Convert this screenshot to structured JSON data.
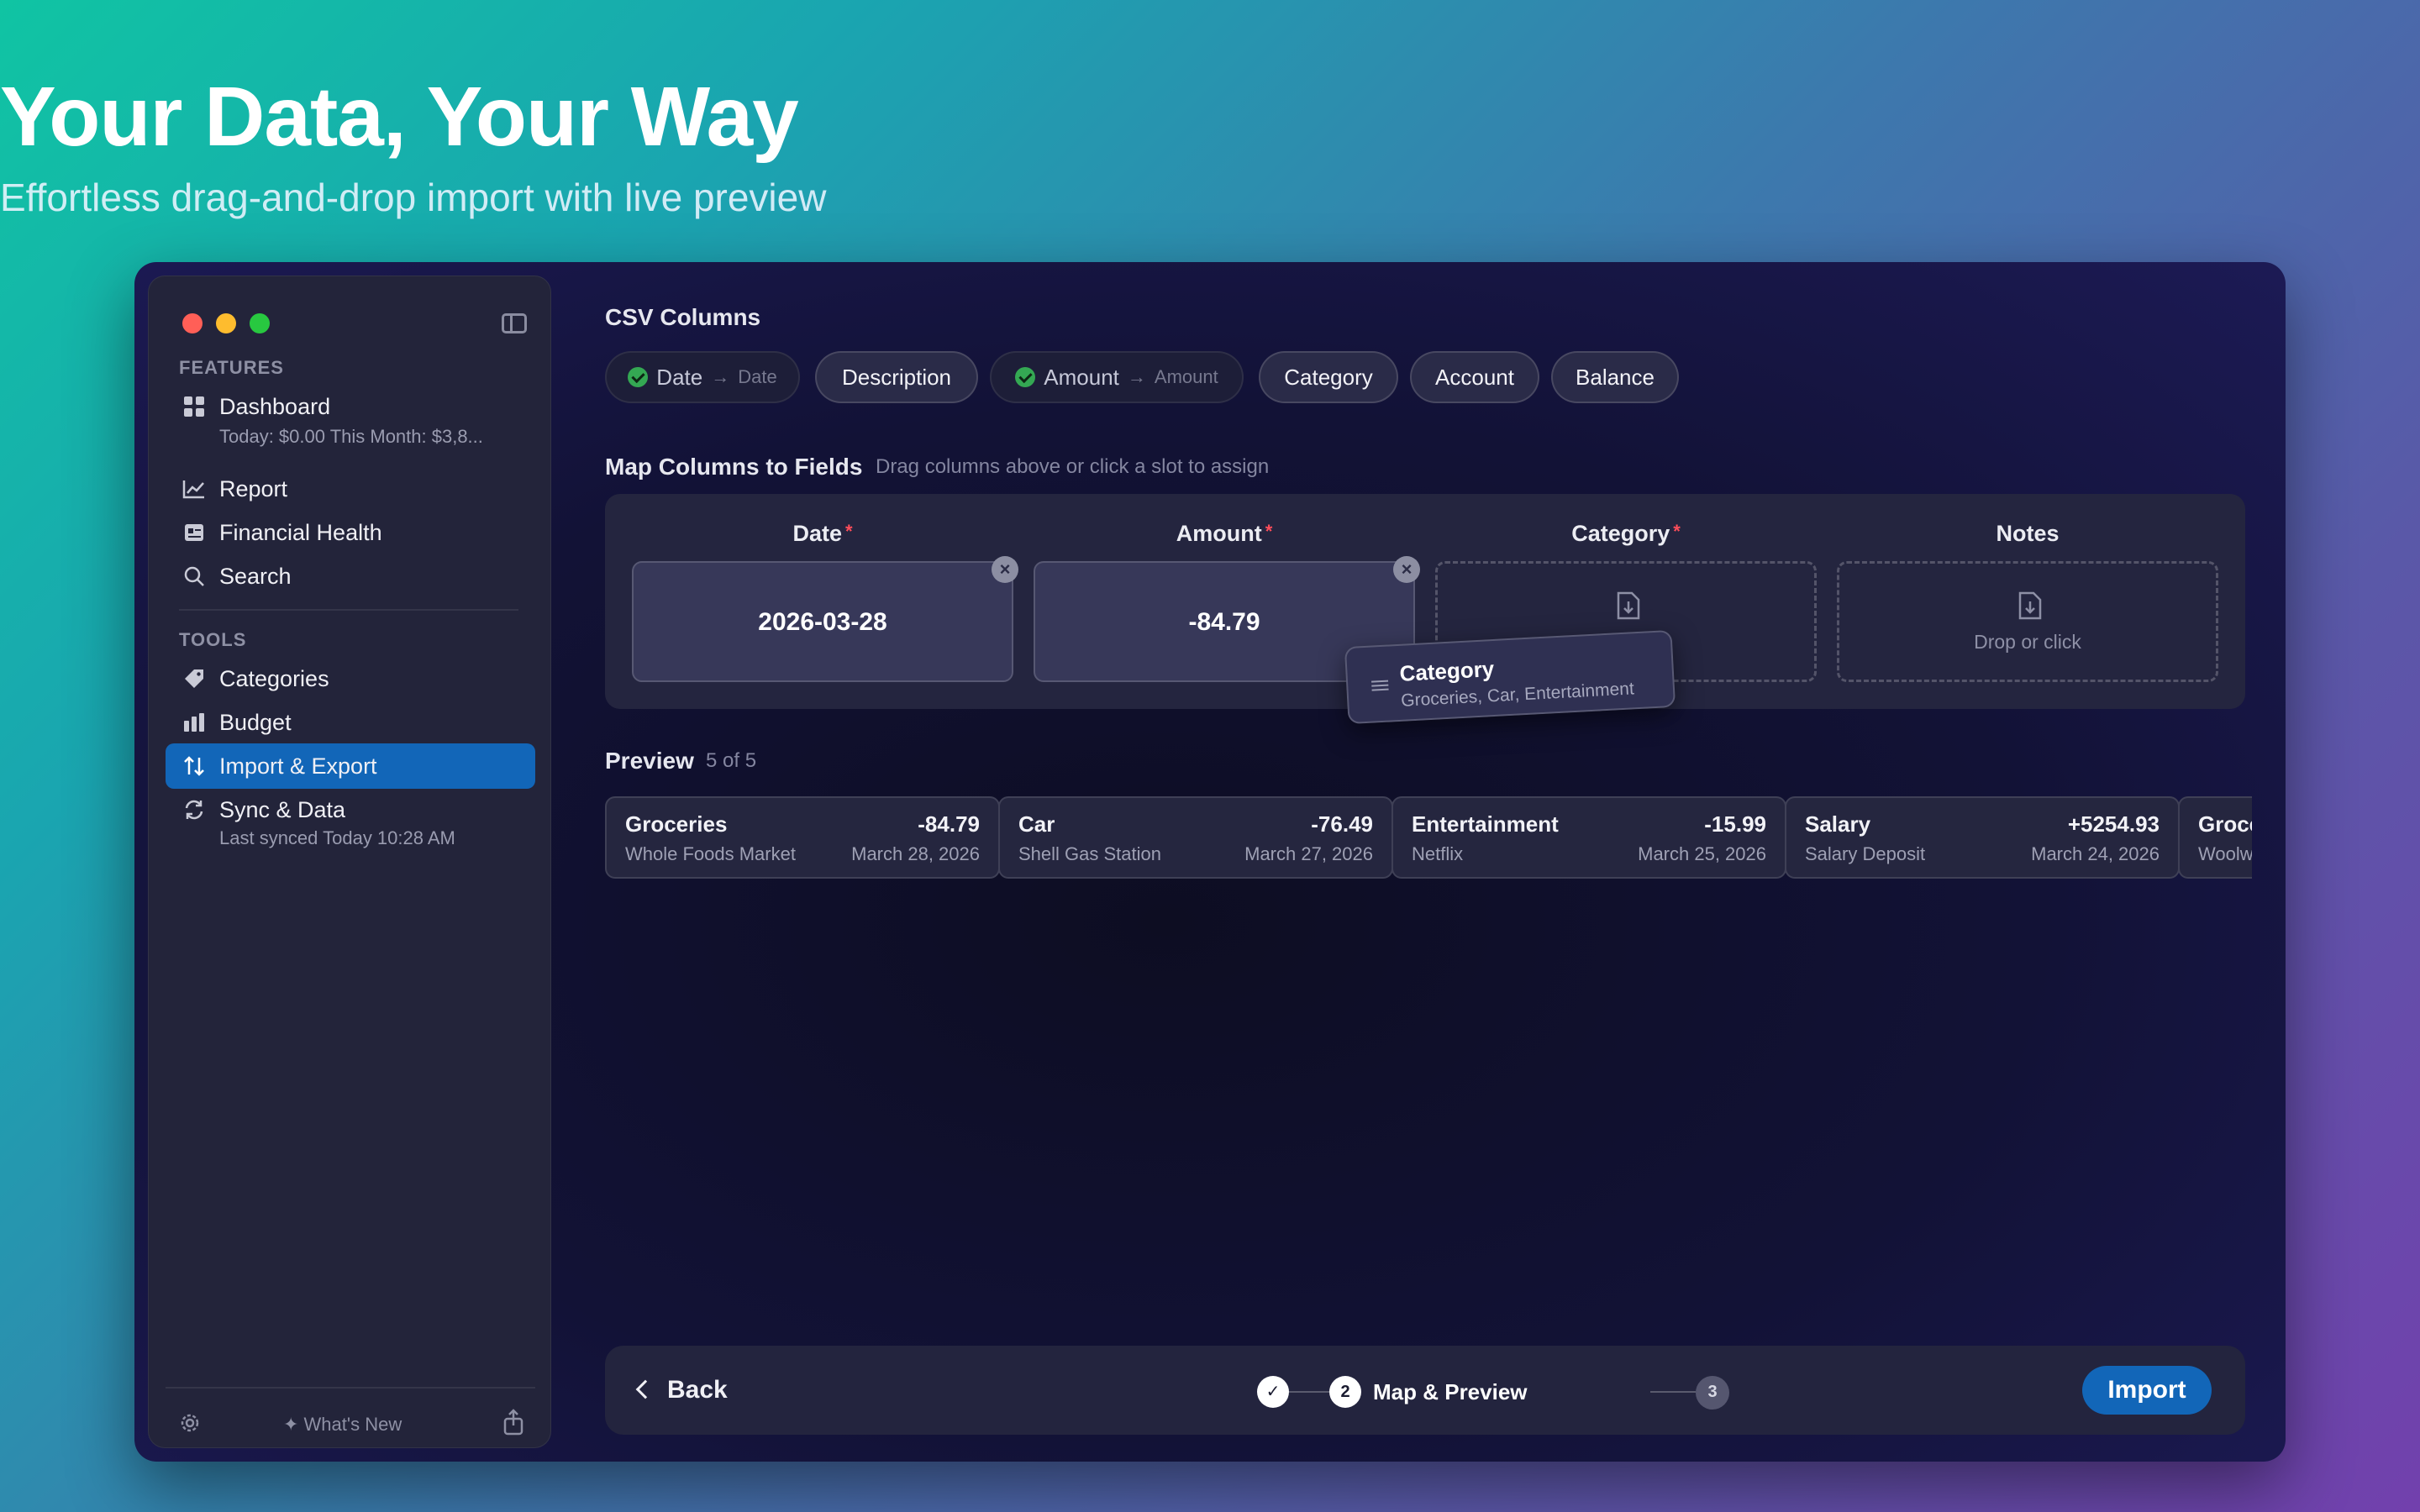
{
  "hero": {
    "title": "Your Data, Your Way",
    "subtitle": "Effortless drag-and-drop import with live preview"
  },
  "sidebar": {
    "features_label": "FEATURES",
    "tools_label": "TOOLS",
    "dashboard": {
      "label": "Dashboard",
      "sub": "Today: $0.00   This Month: $3,8..."
    },
    "report": "Report",
    "financial_health": "Financial Health",
    "search": "Search",
    "categories": "Categories",
    "budget": "Budget",
    "import_export": "Import & Export",
    "sync": {
      "label": "Sync & Data",
      "sub": "Last synced Today 10:28 AM"
    },
    "footer": {
      "whats_new": "What's New"
    }
  },
  "csv": {
    "title": "CSV Columns",
    "columns": [
      {
        "name": "Date",
        "mapped_to": "Date"
      },
      {
        "name": "Description"
      },
      {
        "name": "Amount",
        "mapped_to": "Amount"
      },
      {
        "name": "Category"
      },
      {
        "name": "Account"
      },
      {
        "name": "Balance"
      }
    ]
  },
  "mapping": {
    "title": "Map Columns to Fields",
    "hint": "Drag columns above or click a slot to assign",
    "required_mark": "*",
    "slots": [
      {
        "field": "Date",
        "value": "2026-03-28"
      },
      {
        "field": "Amount",
        "value": "-84.79"
      },
      {
        "field": "Category",
        "value": ""
      },
      {
        "field": "Notes",
        "placeholder": "Drop or click"
      }
    ],
    "clear_glyph": "×"
  },
  "drag_chip": {
    "title": "Category",
    "sub": "Groceries, Car, Entertainment"
  },
  "preview": {
    "title": "Preview",
    "count": "5 of 5",
    "rows": [
      {
        "category": "Groceries",
        "amount": "-84.79",
        "description": "Whole Foods Market",
        "date": "March 28, 2026"
      },
      {
        "category": "Car",
        "amount": "-76.49",
        "description": "Shell Gas Station",
        "date": "March 27, 2026"
      },
      {
        "category": "Entertainment",
        "amount": "-15.99",
        "description": "Netflix",
        "date": "March 25, 2026"
      },
      {
        "category": "Salary",
        "amount": "+5254.93",
        "description": "Salary Deposit",
        "date": "March 24, 2026"
      },
      {
        "category": "Grocer",
        "amount": "",
        "description": "Woolwo",
        "date": ""
      }
    ]
  },
  "footer_bar": {
    "back": "Back",
    "step_done_glyph": "✓",
    "step_current": "2",
    "step_current_label": "Map & Preview",
    "step_next": "3",
    "import": "Import"
  },
  "colors": {
    "accent": "#1266b8",
    "required": "#ff4d5a",
    "check": "#34a853"
  }
}
